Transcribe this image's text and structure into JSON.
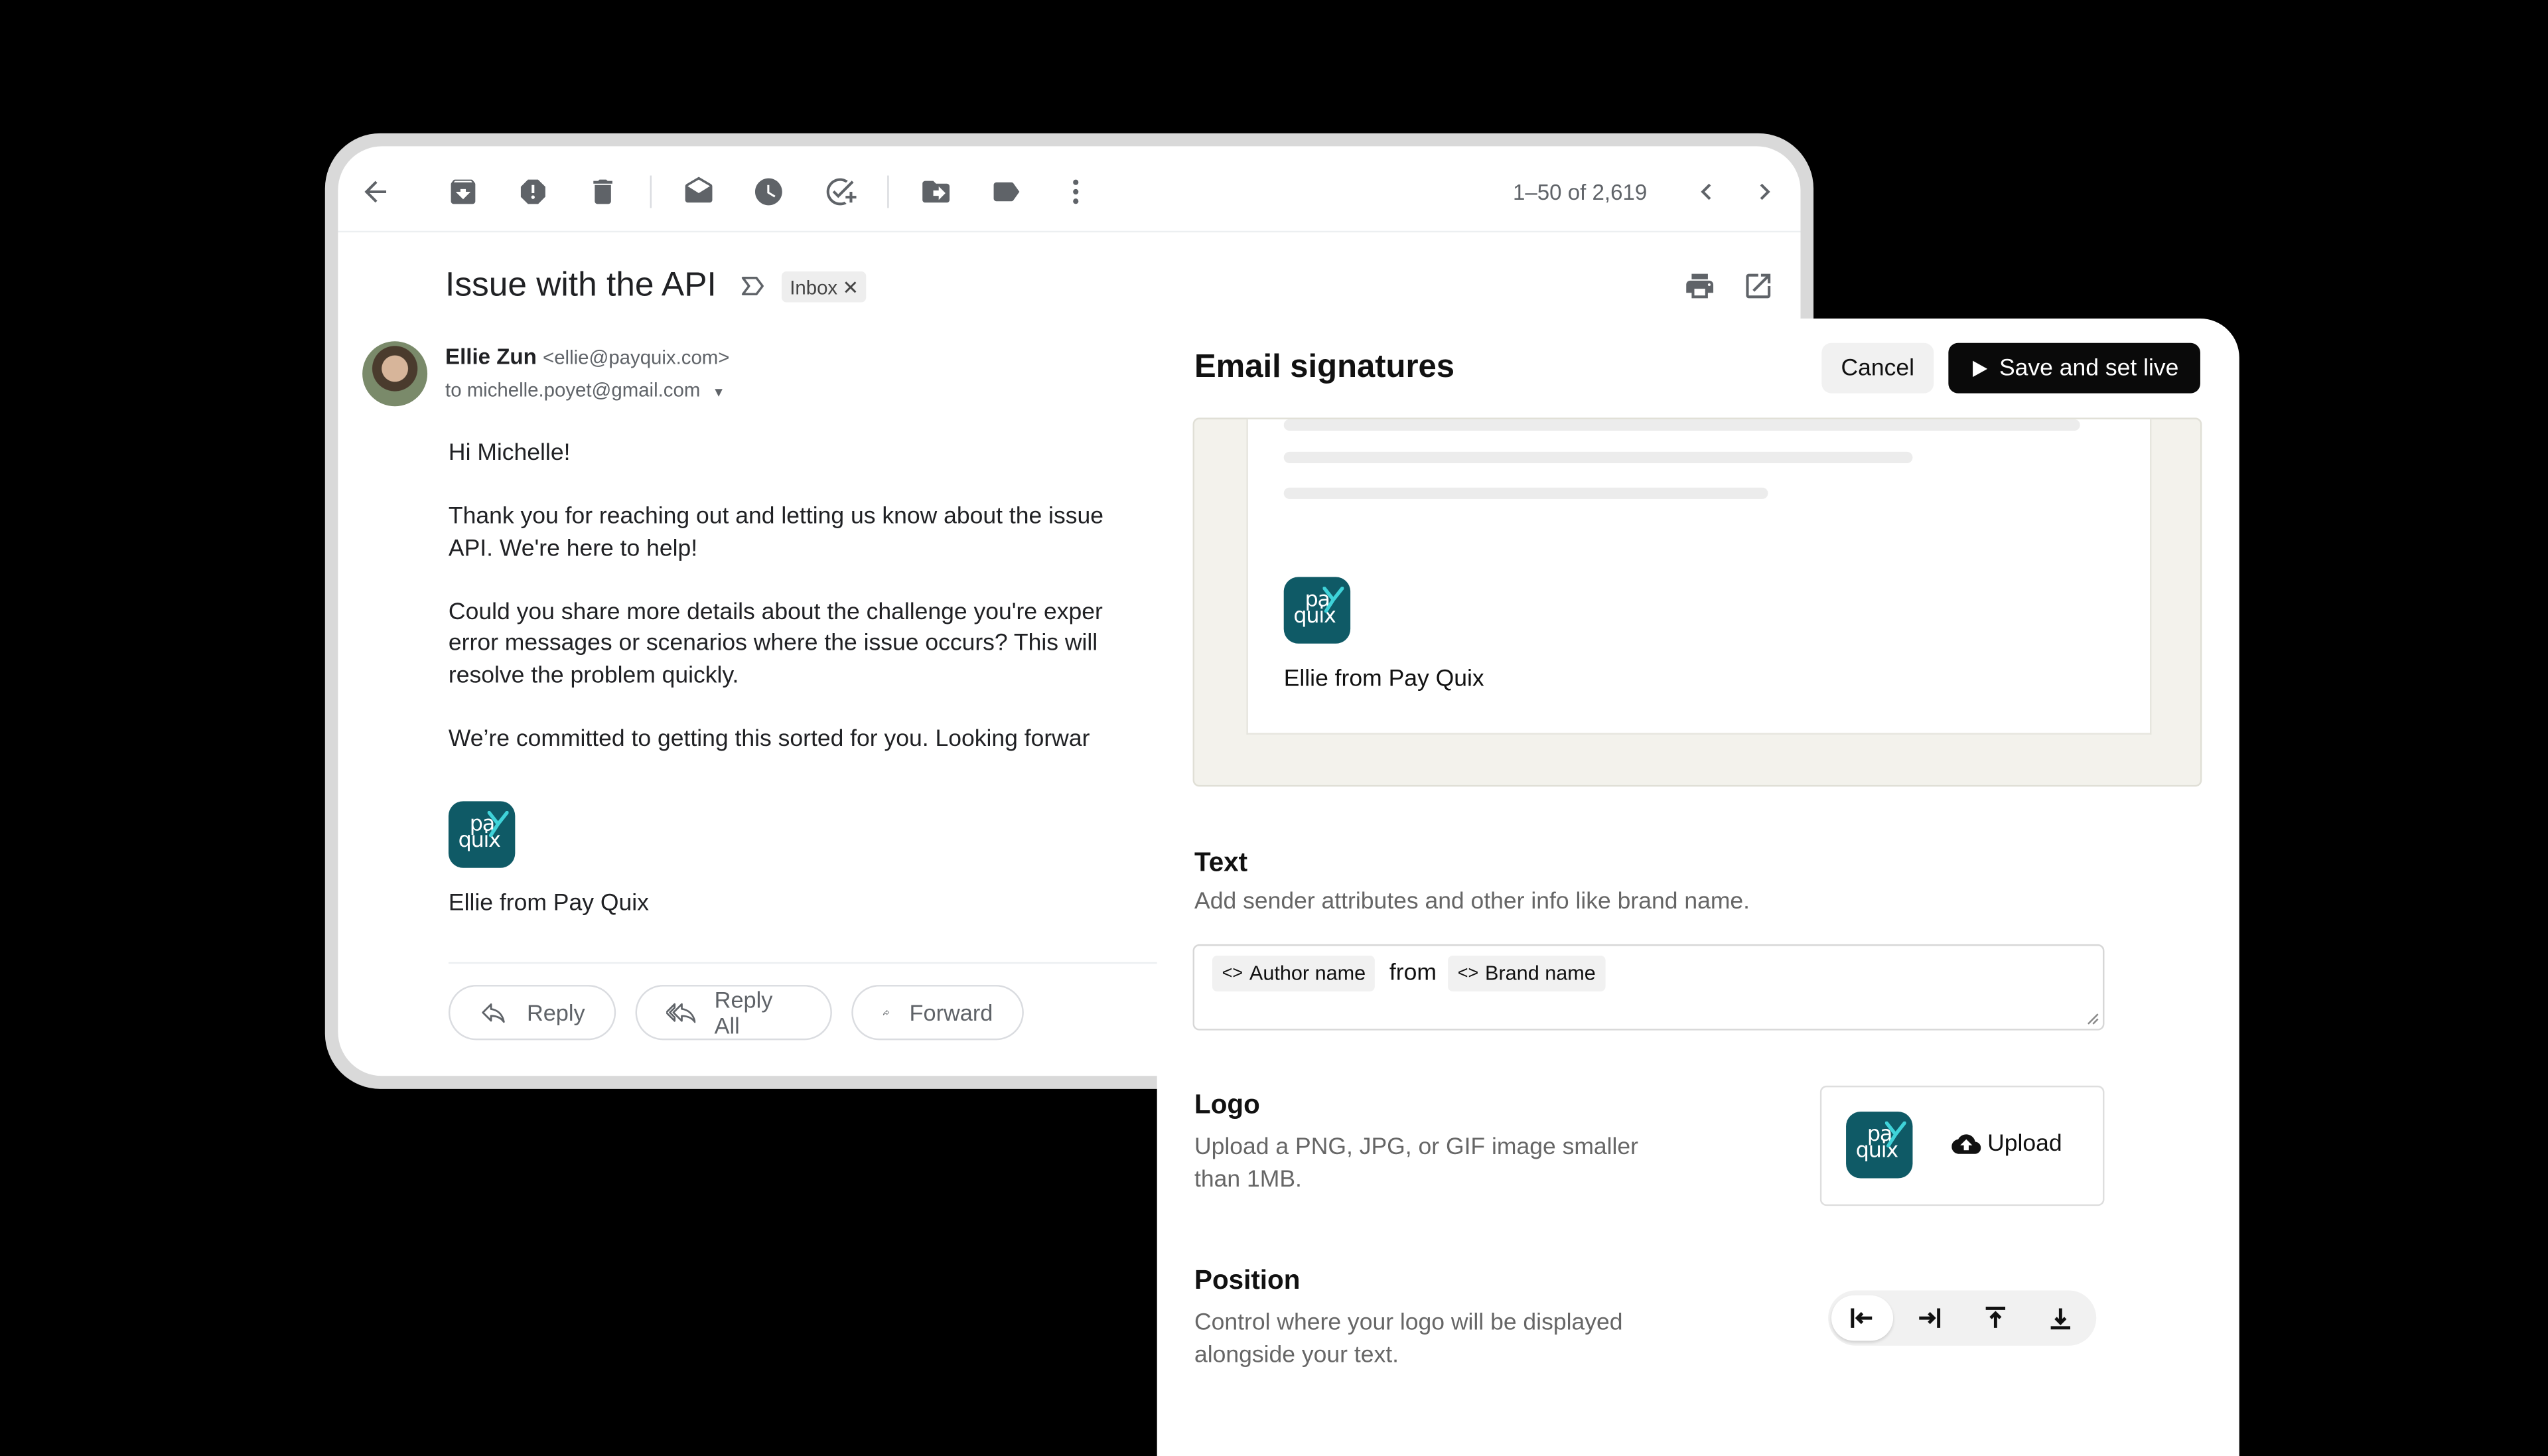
{
  "gmail": {
    "toolbar": {
      "icons": [
        "back-arrow-icon",
        "archive-icon",
        "report-spam-icon",
        "delete-icon",
        "mark-unread-icon",
        "snooze-icon",
        "add-task-icon",
        "move-to-icon",
        "label-icon",
        "more-vert-icon"
      ],
      "pager": "1–50 of 2,619"
    },
    "subject": "Issue with the API",
    "inbox_label": "Inbox",
    "sender_name": "Ellie Zun",
    "sender_email": "<ellie@payquix.com>",
    "recipient": "to michelle.poyet@gmail.com",
    "body": [
      "Hi Michelle!",
      "Thank you for reaching out and letting us know about the issue",
      "API. We're here to help!",
      "Could you share more details about the challenge you're exper",
      "error messages or scenarios where the issue occurs? This will",
      "resolve the problem quickly.",
      "We’re committed to getting this sorted for you. Looking forwar"
    ],
    "signature": "Ellie from Pay Quix",
    "logo_text": {
      "line1": "pa",
      "line2": "quix"
    },
    "buttons": {
      "reply": "Reply",
      "reply_all": "Reply All",
      "forward": "Forward"
    }
  },
  "signature_panel": {
    "title": "Email signatures",
    "cancel": "Cancel",
    "save": "Save and set live",
    "preview_signature": "Ellie from Pay Quix",
    "text_section": {
      "title": "Text",
      "description": "Add sender attributes and other info like brand name.",
      "token_author": "Author name",
      "connector": "from",
      "token_brand": "Brand name"
    },
    "logo_section": {
      "title": "Logo",
      "description_line1": "Upload a PNG, JPG, or GIF image smaller",
      "description_line2": "than 1MB.",
      "upload": "Upload"
    },
    "position_section": {
      "title": "Position",
      "description_line1": "Control where your logo will be displayed",
      "description_line2": "alongside your text.",
      "options": [
        "align-left-icon",
        "align-right-icon",
        "align-top-icon",
        "align-bottom-icon"
      ],
      "selected": "align-left-icon"
    }
  },
  "colors": {
    "brand_teal": "#0f5a66",
    "brand_cyan": "#3fd3d9",
    "save_button": "#0a0a0a",
    "preview_bg": "#f3f2ec"
  }
}
